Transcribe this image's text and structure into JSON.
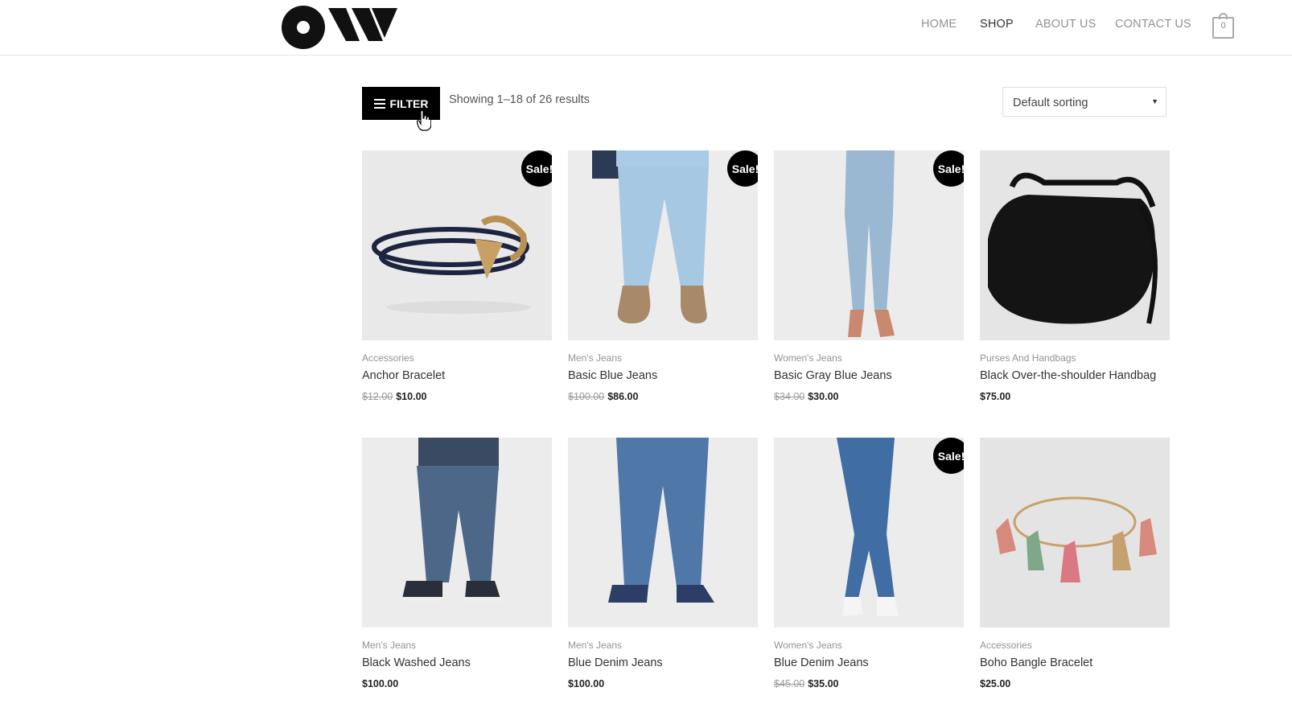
{
  "header": {
    "logo_icon": "ow-logo",
    "nav": [
      "HOME",
      "SHOP",
      "ABOUT US",
      "CONTACT US"
    ],
    "active_nav": "SHOP",
    "cart_count": "0"
  },
  "toolbar": {
    "filter_label": "FILTER",
    "results_text": "Showing 1–18 of 26 results",
    "sort_value": "Default sorting"
  },
  "products": [
    {
      "category": "Accessories",
      "name": "Anchor Bracelet",
      "old_price": "$12.00",
      "price": "$10.00",
      "sale": "Sale!",
      "image": "anchor-bracelet-image"
    },
    {
      "category": "Men's Jeans",
      "name": "Basic Blue Jeans",
      "old_price": "$100.00",
      "price": "$86.00",
      "sale": "Sale!",
      "image": "light-blue-jeans-image"
    },
    {
      "category": "Women's Jeans",
      "name": "Basic Gray Blue Jeans",
      "old_price": "$34.00",
      "price": "$30.00",
      "sale": "Sale!",
      "image": "womens-skinny-jeans-image"
    },
    {
      "category": "Purses And Handbags",
      "name": "Black Over-the-shoulder Handbag",
      "old_price": "",
      "price": "$75.00",
      "sale": "",
      "image": "black-handbag-image"
    },
    {
      "category": "Men's Jeans",
      "name": "Black Washed Jeans",
      "old_price": "",
      "price": "$100.00",
      "sale": "",
      "image": "washed-jeans-image"
    },
    {
      "category": "Men's Jeans",
      "name": "Blue Denim Jeans",
      "old_price": "",
      "price": "$100.00",
      "sale": "",
      "image": "blue-denim-jeans-image"
    },
    {
      "category": "Women's Jeans",
      "name": "Blue Denim Jeans",
      "old_price": "$45.00",
      "price": "$35.00",
      "sale": "Sale!",
      "image": "womens-blue-jeans-image"
    },
    {
      "category": "Accessories",
      "name": "Boho Bangle Bracelet",
      "old_price": "",
      "price": "$25.00",
      "sale": "",
      "image": "boho-bangle-image"
    }
  ]
}
